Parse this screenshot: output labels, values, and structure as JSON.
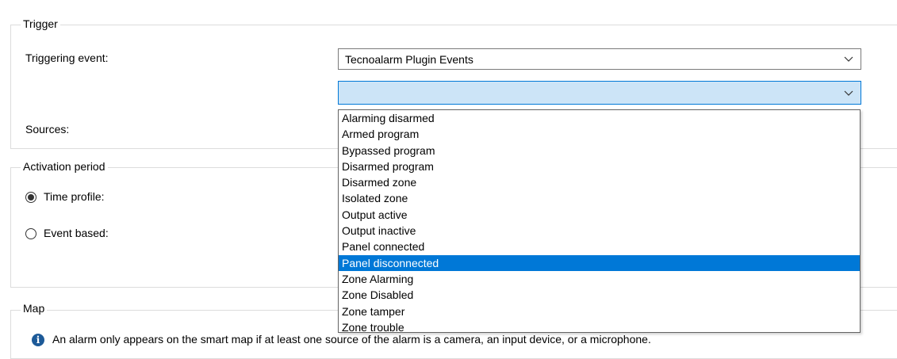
{
  "trigger": {
    "title": "Trigger",
    "triggering_event_label": "Triggering event:",
    "triggering_event_value": "Tecnoalarm Plugin Events",
    "sources_label": "Sources:",
    "event_combo_value": ""
  },
  "dropdown": {
    "items": [
      "Alarming disarmed",
      "Armed program",
      "Bypassed program",
      "Disarmed program",
      "Disarmed zone",
      "Isolated zone",
      "Output active",
      "Output inactive",
      "Panel connected",
      "Panel disconnected",
      "Zone Alarming",
      "Zone Disabled",
      "Zone tamper",
      "Zone trouble"
    ],
    "selected": "Panel disconnected"
  },
  "activation": {
    "title": "Activation period",
    "time_profile_label": "Time profile:",
    "event_based_label": "Event based:",
    "selected": "time_profile"
  },
  "map": {
    "title": "Map",
    "info_icon": "i",
    "info_text": "An alarm only appears on the smart map if at least one source of the alarm is a camera, an input device, or a microphone."
  },
  "colors": {
    "selection": "#0078d7",
    "open_combo": "#cce4f7",
    "info_icon": "#1d5a98"
  }
}
